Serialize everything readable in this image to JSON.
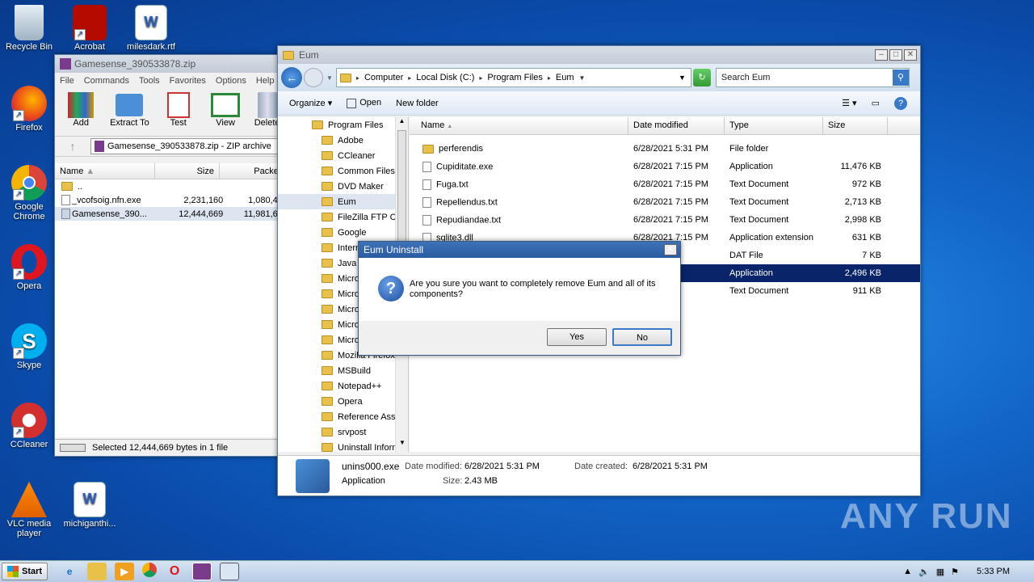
{
  "desktop": {
    "icons": [
      {
        "label": "Recycle Bin"
      },
      {
        "label": "Acrobat"
      },
      {
        "label": "milesdark.rtf"
      },
      {
        "label": "Firefox"
      },
      {
        "label": "Google Chrome"
      },
      {
        "label": "Opera"
      },
      {
        "label": "Skype"
      },
      {
        "label": "CCleaner"
      },
      {
        "label": "VLC media player"
      },
      {
        "label": "michiganthi..."
      }
    ]
  },
  "winrar": {
    "title": "Gamesense_390533878.zip",
    "menu": [
      "File",
      "Commands",
      "Tools",
      "Favorites",
      "Options",
      "Help"
    ],
    "toolbar": [
      "Add",
      "Extract To",
      "Test",
      "View",
      "Delete"
    ],
    "path": "Gamesense_390533878.zip - ZIP archive",
    "columns": {
      "name": "Name",
      "size": "Size",
      "packed": "Packed"
    },
    "rows": [
      {
        "name": "..",
        "size": "",
        "packed": ""
      },
      {
        "name": "_vcofsoig.nfn.exe",
        "size": "2,231,160",
        "packed": "1,080,440"
      },
      {
        "name": "Gamesense_390...",
        "size": "12,444,669",
        "packed": "11,981,602"
      }
    ],
    "status": "Selected 12,444,669 bytes in 1 file"
  },
  "explorer": {
    "title": "Eum",
    "breadcrumb": [
      "Computer",
      "Local Disk (C:)",
      "Program Files",
      "Eum"
    ],
    "search_placeholder": "Search Eum",
    "toolbar": {
      "organize": "Organize",
      "open": "Open",
      "new_folder": "New folder"
    },
    "tree": [
      "Program Files",
      "Adobe",
      "CCleaner",
      "Common Files",
      "DVD Maker",
      "Eum",
      "FileZilla FTP Clie",
      "Google",
      "Intern",
      "Java",
      "Micros",
      "Micros",
      "Micros",
      "Micros",
      "Micros",
      "Mozilla Firefox",
      "MSBuild",
      "Notepad++",
      "Opera",
      "Reference Ass",
      "srvpost",
      "Uninstall Inform"
    ],
    "columns": {
      "name": "Name",
      "date": "Date modified",
      "type": "Type",
      "size": "Size"
    },
    "files": [
      {
        "name": "perferendis",
        "date": "6/28/2021 5:31 PM",
        "type": "File folder",
        "size": ""
      },
      {
        "name": "Cupiditate.exe",
        "date": "6/28/2021 7:15 PM",
        "type": "Application",
        "size": "11,476 KB"
      },
      {
        "name": "Fuga.txt",
        "date": "6/28/2021 7:15 PM",
        "type": "Text Document",
        "size": "972 KB"
      },
      {
        "name": "Repellendus.txt",
        "date": "6/28/2021 7:15 PM",
        "type": "Text Document",
        "size": "2,713 KB"
      },
      {
        "name": "Repudiandae.txt",
        "date": "6/28/2021 7:15 PM",
        "type": "Text Document",
        "size": "2,998 KB"
      },
      {
        "name": "sqlite3.dll",
        "date": "6/28/2021 7:15 PM",
        "type": "Application extension",
        "size": "631 KB"
      },
      {
        "name": "",
        "date": "31 PM",
        "type": "DAT File",
        "size": "7 KB"
      },
      {
        "name": "",
        "date": "31 PM",
        "type": "Application",
        "size": "2,496 KB"
      },
      {
        "name": "",
        "date": "15 PM",
        "type": "Text Document",
        "size": "911 KB"
      }
    ],
    "details": {
      "filename": "unins000.exe",
      "modified_label": "Date modified:",
      "modified": "6/28/2021 5:31 PM",
      "created_label": "Date created:",
      "created": "6/28/2021 5:31 PM",
      "type": "Application",
      "size_label": "Size:",
      "size": "2.43 MB"
    }
  },
  "dialog": {
    "title": "Eum Uninstall",
    "message": "Are you sure you want to completely remove Eum and all of its components?",
    "yes": "Yes",
    "no": "No"
  },
  "taskbar": {
    "start": "Start",
    "clock": "5:33 PM"
  },
  "watermark": "ANY RUN"
}
